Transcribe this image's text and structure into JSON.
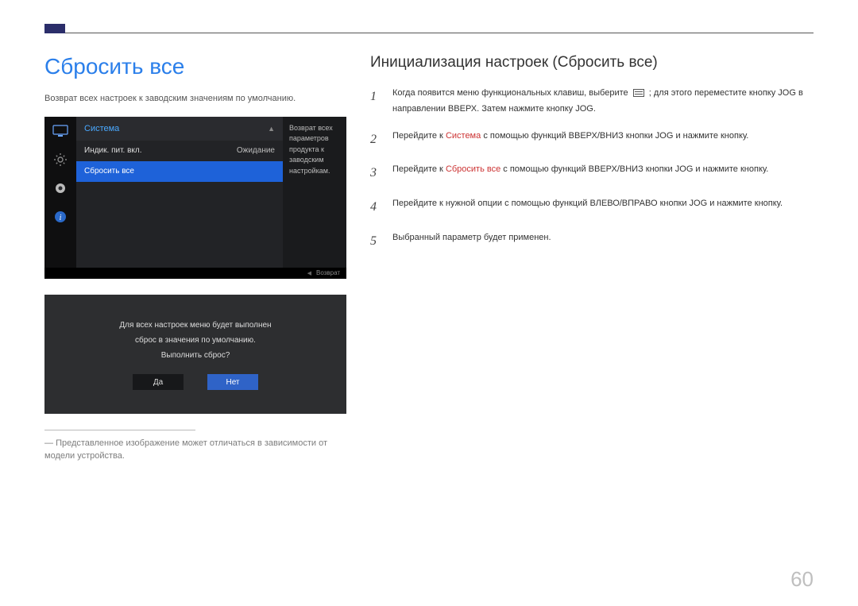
{
  "section_title": "Сбросить все",
  "intro": "Возврат всех настроек к заводским значениям по умолчанию.",
  "osd": {
    "menu_name": "Система",
    "rows": [
      {
        "label": "Индик. пит. вкл.",
        "value": "Ожидание"
      },
      {
        "label": "Сбросить все",
        "value": ""
      }
    ],
    "side_text": "Возврат всех параметров продукта к заводским настройкам.",
    "return_label": "Возврат"
  },
  "confirm": {
    "line1": "Для всех настроек меню будет выполнен",
    "line2": "сброс в значения по умолчанию.",
    "line3": "Выполнить сброс?",
    "yes": "Да",
    "no": "Нет"
  },
  "footnote": "Представленное изображение может отличаться в зависимости от модели устройства.",
  "right_title": "Инициализация настроек (Сбросить все)",
  "steps": {
    "s1a": "Когда появится меню функциональных клавиш, выберите ",
    "s1b": " ; для этого переместите кнопку JOG в направлении ВВЕРХ. Затем нажмите кнопку JOG.",
    "s2a": "Перейдите к ",
    "s2kw": "Система",
    "s2b": " с помощью функций ВВЕРХ/ВНИЗ кнопки JOG и нажмите кнопку.",
    "s3a": "Перейдите к ",
    "s3kw": "Сбросить все",
    "s3b": " с помощью функций ВВЕРХ/ВНИЗ кнопки JOG и нажмите кнопку.",
    "s4": "Перейдите к нужной опции с помощью функций ВЛЕВО/ВПРАВО кнопки JOG и нажмите кнопку.",
    "s5": "Выбранный параметр будет применен."
  },
  "page_number": "60"
}
